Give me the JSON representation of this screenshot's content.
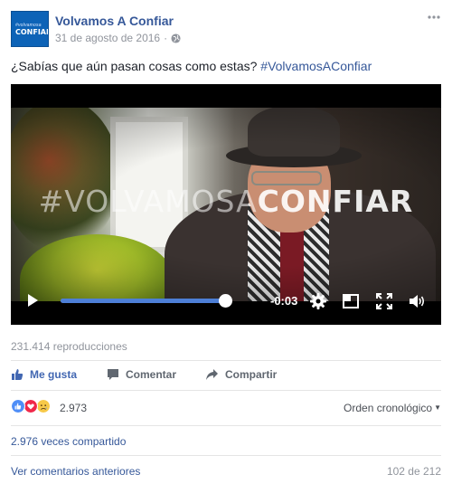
{
  "post": {
    "page_name": "Volvamos A Confiar",
    "date": "31 de agosto de 2016",
    "separator": "·",
    "text_prefix": "¿Sabías que aún pasan cosas como estas? ",
    "hashtag": "#VolvamosAConfiar",
    "avatar_line1": "#volvamosa",
    "avatar_line2": "CONFIAR"
  },
  "video": {
    "overlay_light": "#VOLVAMOSA",
    "overlay_strong": "CONFIAR",
    "time_remaining": "-0:03",
    "progress_fraction": 0.96
  },
  "stats": {
    "views": "231.414 reproducciones"
  },
  "actions": {
    "like": "Me gusta",
    "comment": "Comentar",
    "share": "Compartir"
  },
  "reactions": {
    "count": "2.973",
    "order": "Orden cronológico",
    "types": [
      "like-icon",
      "love-icon",
      "sad-icon"
    ]
  },
  "shares": {
    "text": "2.976 veces compartido"
  },
  "comments": {
    "previous": "Ver comentarios anteriores",
    "counter": "102 de 212"
  },
  "colors": {
    "link_blue": "#365899",
    "like_blue": "#4267b2",
    "progress_blue": "#4d7fd6",
    "muted_gray": "#90949c"
  }
}
